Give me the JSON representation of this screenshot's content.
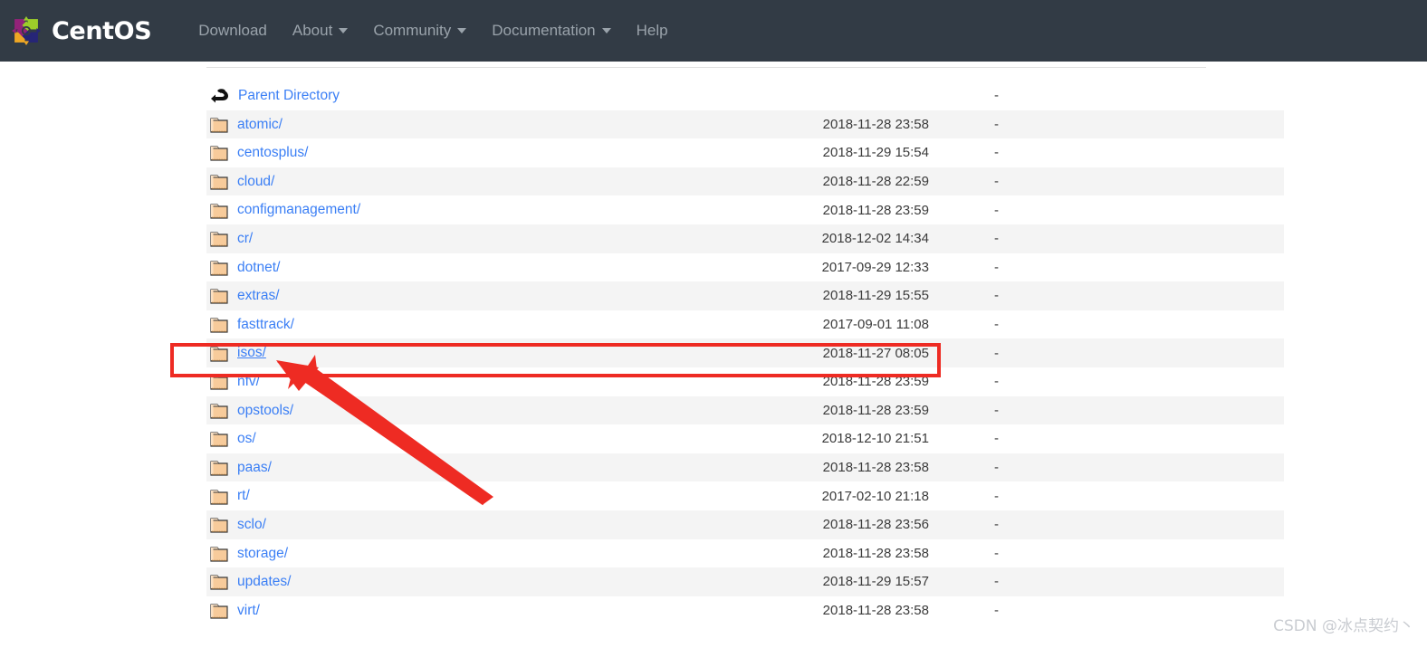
{
  "navbar": {
    "brand_label": "CentOS",
    "brand_icon": "centos-logo-icon",
    "logo_colors": [
      "#932279",
      "#efa724",
      "#262577",
      "#9ccd2a"
    ],
    "background_color": "#323b45",
    "link_color": "#9aa3ab",
    "items": [
      {
        "label": "Download",
        "has_dropdown": false
      },
      {
        "label": "About",
        "has_dropdown": true
      },
      {
        "label": "Community",
        "has_dropdown": true
      },
      {
        "label": "Documentation",
        "has_dropdown": true
      },
      {
        "label": "Help",
        "has_dropdown": false
      }
    ]
  },
  "listing": {
    "link_color": "#3b7ff5",
    "stripe_color": "#f4f4f4",
    "rows": [
      {
        "name": "Parent Directory",
        "icon": "back-arrow-icon",
        "date": "",
        "size": "-",
        "striped": false,
        "hovered": false,
        "highlighted": false
      },
      {
        "name": "atomic/",
        "icon": "folder-icon",
        "date": "2018-11-28 23:58",
        "size": "-",
        "striped": true,
        "hovered": false,
        "highlighted": false
      },
      {
        "name": "centosplus/",
        "icon": "folder-icon",
        "date": "2018-11-29 15:54",
        "size": "-",
        "striped": false,
        "hovered": false,
        "highlighted": false
      },
      {
        "name": "cloud/",
        "icon": "folder-icon",
        "date": "2018-11-28 22:59",
        "size": "-",
        "striped": true,
        "hovered": false,
        "highlighted": false
      },
      {
        "name": "configmanagement/",
        "icon": "folder-icon",
        "date": "2018-11-28 23:59",
        "size": "-",
        "striped": false,
        "hovered": false,
        "highlighted": false
      },
      {
        "name": "cr/",
        "icon": "folder-icon",
        "date": "2018-12-02 14:34",
        "size": "-",
        "striped": true,
        "hovered": false,
        "highlighted": false
      },
      {
        "name": "dotnet/",
        "icon": "folder-icon",
        "date": "2017-09-29 12:33",
        "size": "-",
        "striped": false,
        "hovered": false,
        "highlighted": false
      },
      {
        "name": "extras/",
        "icon": "folder-icon",
        "date": "2018-11-29 15:55",
        "size": "-",
        "striped": true,
        "hovered": false,
        "highlighted": false
      },
      {
        "name": "fasttrack/",
        "icon": "folder-icon",
        "date": "2017-09-01 11:08",
        "size": "-",
        "striped": false,
        "hovered": false,
        "highlighted": false
      },
      {
        "name": "isos/",
        "icon": "folder-icon",
        "date": "2018-11-27 08:05",
        "size": "-",
        "striped": true,
        "hovered": true,
        "highlighted": true
      },
      {
        "name": "nfv/",
        "icon": "folder-icon",
        "date": "2018-11-28 23:59",
        "size": "-",
        "striped": false,
        "hovered": false,
        "highlighted": false
      },
      {
        "name": "opstools/",
        "icon": "folder-icon",
        "date": "2018-11-28 23:59",
        "size": "-",
        "striped": true,
        "hovered": false,
        "highlighted": false
      },
      {
        "name": "os/",
        "icon": "folder-icon",
        "date": "2018-12-10 21:51",
        "size": "-",
        "striped": false,
        "hovered": false,
        "highlighted": false
      },
      {
        "name": "paas/",
        "icon": "folder-icon",
        "date": "2018-11-28 23:58",
        "size": "-",
        "striped": true,
        "hovered": false,
        "highlighted": false
      },
      {
        "name": "rt/",
        "icon": "folder-icon",
        "date": "2017-02-10 21:18",
        "size": "-",
        "striped": false,
        "hovered": false,
        "highlighted": false
      },
      {
        "name": "sclo/",
        "icon": "folder-icon",
        "date": "2018-11-28 23:56",
        "size": "-",
        "striped": true,
        "hovered": false,
        "highlighted": false
      },
      {
        "name": "storage/",
        "icon": "folder-icon",
        "date": "2018-11-28 23:58",
        "size": "-",
        "striped": false,
        "hovered": false,
        "highlighted": false
      },
      {
        "name": "updates/",
        "icon": "folder-icon",
        "date": "2018-11-29 15:57",
        "size": "-",
        "striped": true,
        "hovered": false,
        "highlighted": false
      },
      {
        "name": "virt/",
        "icon": "folder-icon",
        "date": "2018-11-28 23:58",
        "size": "-",
        "striped": false,
        "hovered": false,
        "highlighted": false
      }
    ]
  },
  "annotations": {
    "color": "#ee2b23",
    "highlight_target": "isos/",
    "shapes": [
      "highlight-rectangle",
      "pointer-arrow"
    ]
  },
  "watermark": {
    "text": "CSDN @冰点契约丶"
  }
}
